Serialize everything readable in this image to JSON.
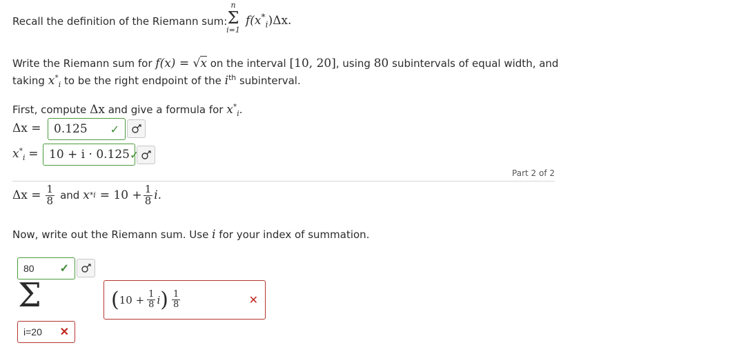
{
  "intro": {
    "prefix": "Recall the definition of the Riemann sum:",
    "upper": "n",
    "lower": "i=1",
    "term": "f(x",
    "term_sub": "i",
    "term_rest": ")Δx."
  },
  "problem": {
    "p1": "Write the Riemann sum for",
    "fx": "f(x) = ",
    "sqrt_var": "x",
    "p2": "on the interval",
    "interval": "[10, 20]",
    "p3": ", using",
    "n": "80",
    "p4": "subintervals of equal width, and",
    "p5": "taking",
    "xi": "x",
    "xi_sub": "i",
    "p6": "to be the right endpoint of the",
    "ith_var": "i",
    "ith_sup": "th",
    "p7": "subinterval."
  },
  "part1": {
    "instr_a": "First, compute",
    "dx": "Δx",
    "instr_b": "and give a formula for",
    "xi": "x",
    "xi_sub": "i",
    "period": ".",
    "dx_label": "Δx =",
    "dx_value": "0.125",
    "xi_label_sub": "i",
    "xi_label_eq": "=",
    "xi_value": "10 + i · 0.125"
  },
  "part_label": "Part 2 of 2",
  "summary": {
    "dx": "Δx =",
    "frac_num": "1",
    "frac_den": "8",
    "and": "and",
    "xi": "x",
    "xi_sub": "i",
    "eq_ten": "= 10 +",
    "frac2_num": "1",
    "frac2_den": "8",
    "tail": "i."
  },
  "part2": {
    "instr_a": "Now, write out the Riemann sum. Use",
    "var": "i",
    "instr_b": "for your index of summation.",
    "upper_value": "80",
    "lower_value": "i=20",
    "term_ten": "10 +",
    "term_num": "1",
    "term_den": "8",
    "term_i": "i",
    "term_fnum": "1",
    "term_fden": "8"
  },
  "icons": {
    "check": "✓",
    "cross": "✕",
    "sigma": "Σ"
  },
  "colors": {
    "correct": "#4a9b3c",
    "incorrect": "#b5342e"
  }
}
